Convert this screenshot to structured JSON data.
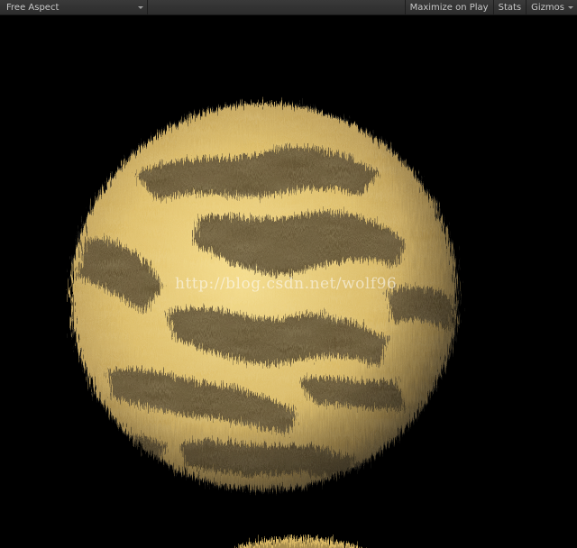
{
  "toolbar": {
    "aspect_label": "Free Aspect",
    "maximize_label": "Maximize on Play",
    "stats_label": "Stats",
    "gizmos_label": "Gizmos"
  },
  "viewport": {
    "background_color": "#000000",
    "object": "fur-sphere",
    "fur_light_color": "#f0d37a",
    "fur_dark_color": "#4a3b22"
  },
  "watermark": {
    "text": "http://blog.csdn.net/wolf96"
  }
}
